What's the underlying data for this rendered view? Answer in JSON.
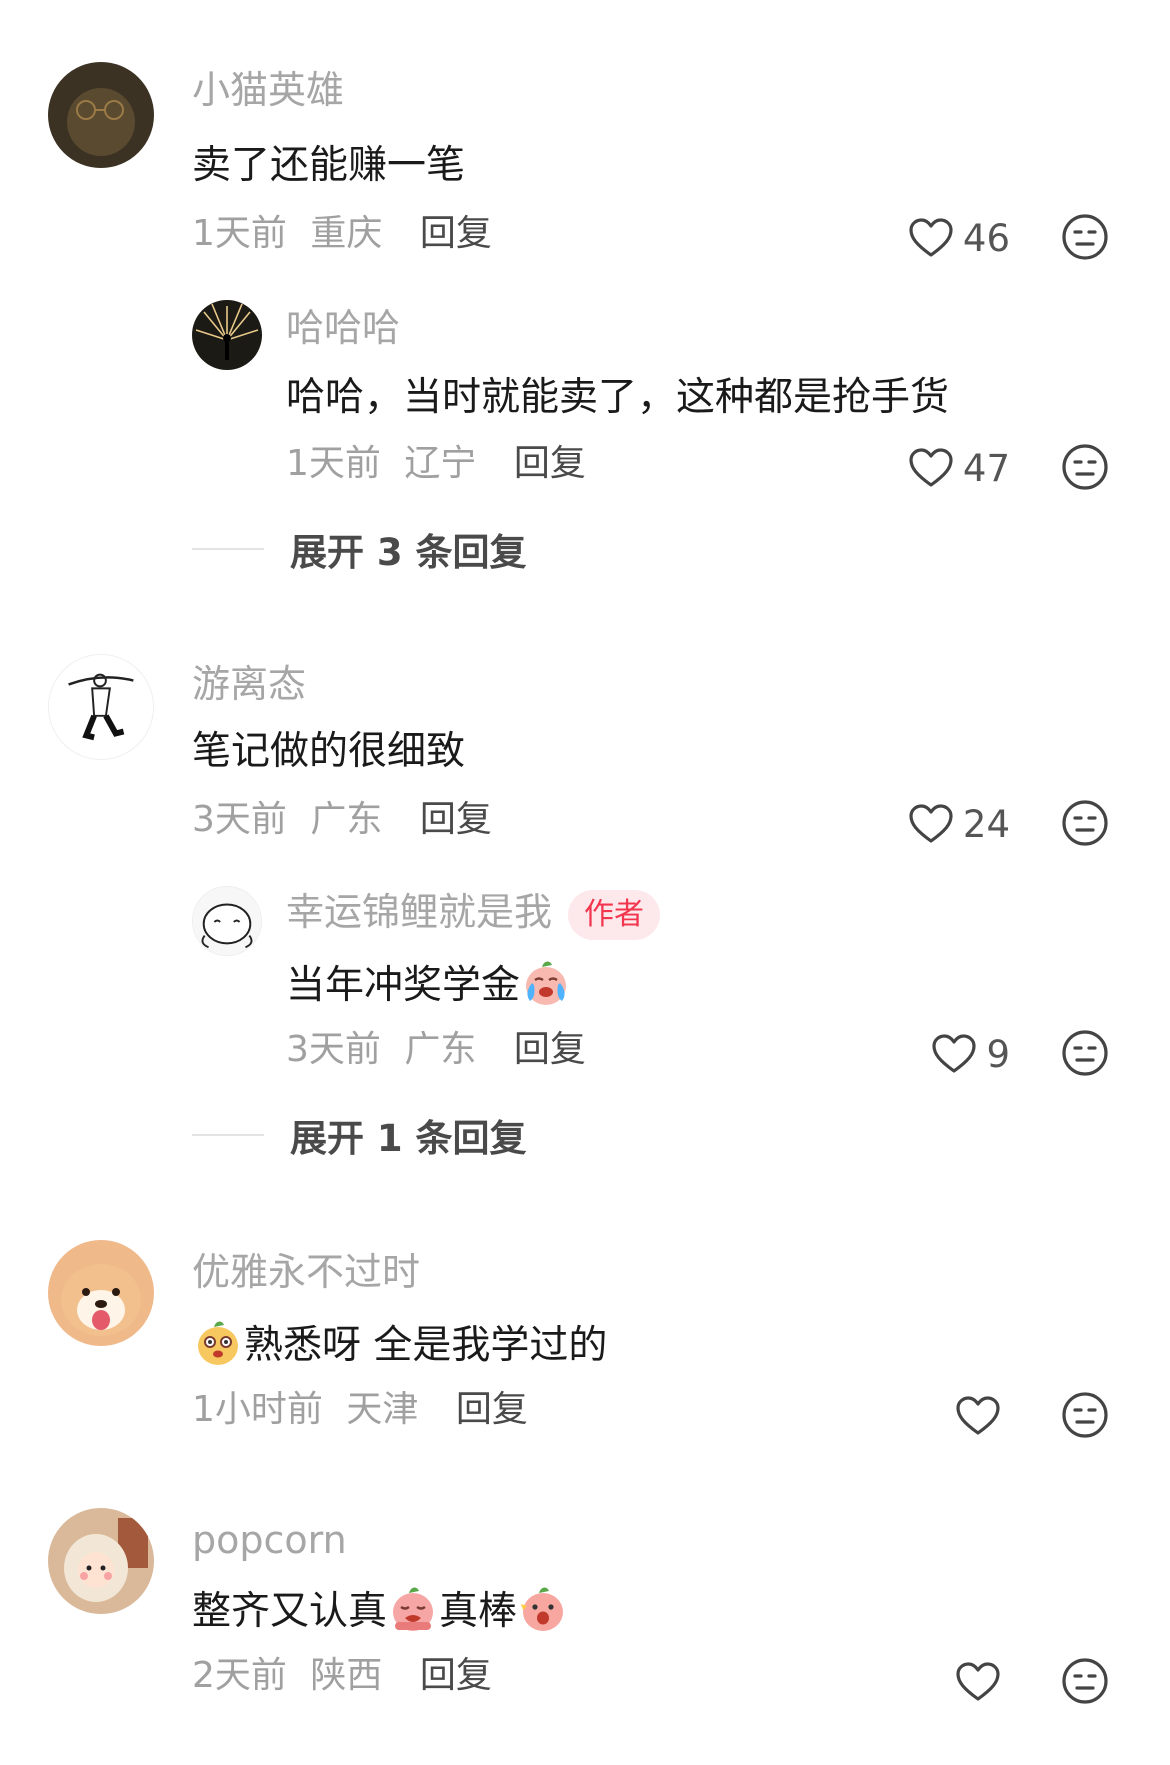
{
  "comments": [
    {
      "username": "小猫英雄",
      "text": "卖了还能赚一笔",
      "time": "1天前",
      "location": "重庆",
      "reply_label": "回复",
      "likes": "46",
      "replies": [
        {
          "username": "哈哈哈",
          "text": "哈哈，当时就能卖了，这种都是抢手货",
          "time": "1天前",
          "location": "辽宁",
          "reply_label": "回复",
          "likes": "47"
        }
      ],
      "expand_label": "展开 3 条回复"
    },
    {
      "username": "游离态",
      "text": "笔记做的很细致",
      "time": "3天前",
      "location": "广东",
      "reply_label": "回复",
      "likes": "24",
      "replies": [
        {
          "username": "幸运锦鲤就是我",
          "author_tag": "作者",
          "text": "当年冲奖学金",
          "time": "3天前",
          "location": "广东",
          "reply_label": "回复",
          "likes": "9"
        }
      ],
      "expand_label": "展开 1 条回复"
    },
    {
      "username": "优雅永不过时",
      "text": "熟悉呀 全是我学过的",
      "time": "1小时前",
      "location": "天津",
      "reply_label": "回复",
      "likes": ""
    },
    {
      "username": "popcorn",
      "text_part1": "整齐又认真",
      "text_part2": "真棒",
      "time": "2天前",
      "location": "陕西",
      "reply_label": "回复",
      "likes": ""
    }
  ],
  "icons": {
    "like": "heart-outline-icon",
    "dislike": "meh-face-icon"
  },
  "colors": {
    "author_tag_bg": "#fde9ec",
    "author_tag_text": "#f2364e"
  }
}
